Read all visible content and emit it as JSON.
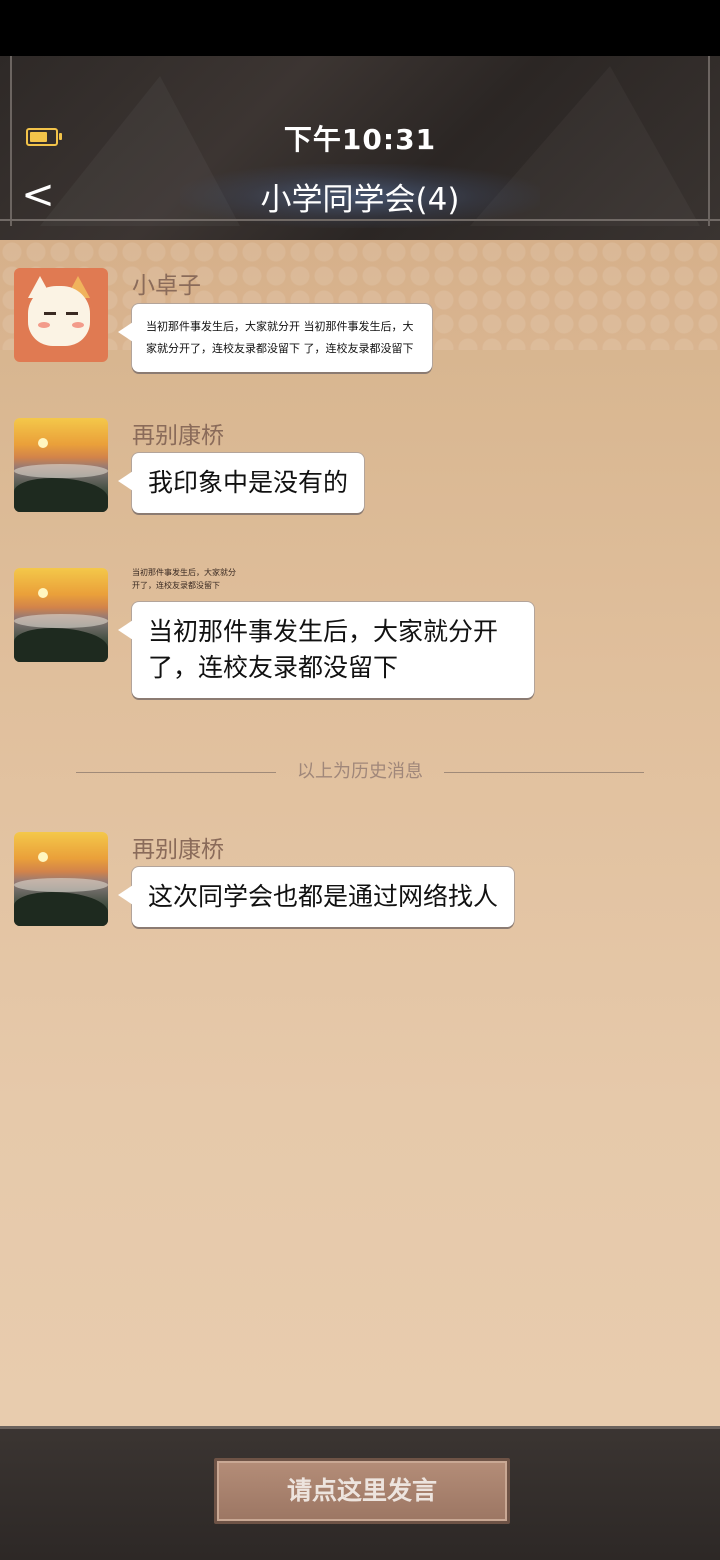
{
  "status": {
    "time": "下午10:31"
  },
  "header": {
    "back_label": "<",
    "title": "小学同学会(4)"
  },
  "messages": [
    {
      "sender": "小卓子",
      "avatar": "cat-avatar",
      "text": "当初那件事发生后，大家就分开 当初那件事发生后，大家就分开了，连校友录都没留下           了，连校友录都没留下"
    },
    {
      "sender": "再别康桥",
      "avatar": "landscape-avatar",
      "text": "我印象中是没有的"
    },
    {
      "sender": "",
      "caption": "当初那件事发生后，大家就分开了，连校友录都没留下",
      "avatar": "landscape-avatar",
      "text": "当初那件事发生后，大家就分开了，连校友录都没留下"
    },
    {
      "sender": "再别康桥",
      "avatar": "landscape-avatar",
      "text": "这次同学会也都是通过网络找人"
    }
  ],
  "divider": {
    "label": "以上为历史消息"
  },
  "footer": {
    "button_label": "请点这里发言"
  },
  "colors": {
    "accent": "#f2c34a",
    "sender": "#8a6b5a",
    "bubble": "#ffffff"
  }
}
